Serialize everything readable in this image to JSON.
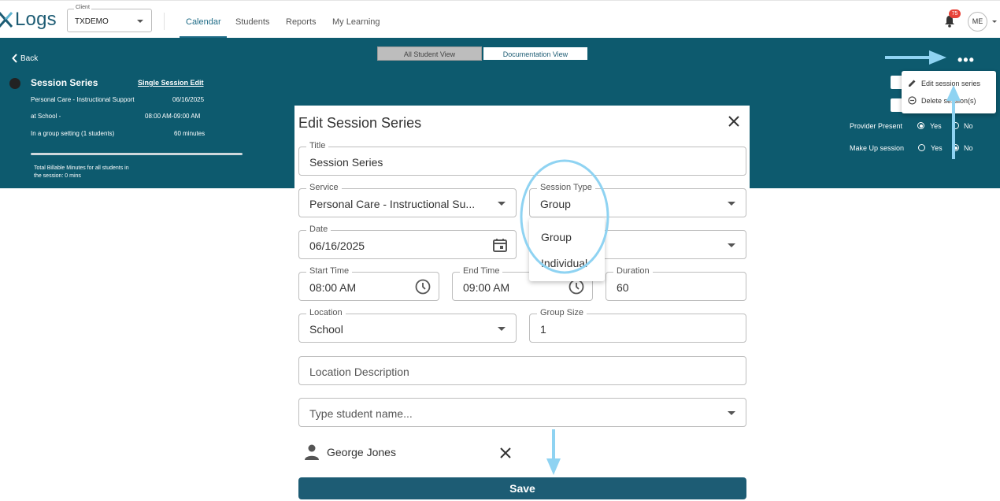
{
  "app": {
    "name": "Logs",
    "brand_color": "#1d5c74",
    "band_color": "#0d5a6e"
  },
  "client": {
    "label": "Client",
    "value": "TXDEMO"
  },
  "nav": [
    "Calendar",
    "Students",
    "Reports",
    "My Learning"
  ],
  "notifications": {
    "count": "75"
  },
  "user": {
    "initials": "ME"
  },
  "view_toggle": {
    "all": "All Student View",
    "doc": "Documentation View",
    "active": "Documentation View"
  },
  "back_label": "Back",
  "session_summary": {
    "title": "Session Series",
    "edit_link": "Single Session Edit",
    "service": "Personal Care - Instructional Support",
    "date": "06/16/2025",
    "location": "at School -",
    "time": "08:00 AM-09:00 AM",
    "group": "In a group setting (1 students)",
    "duration": "60 minutes",
    "billable_line1": "Total Billable Minutes for all students in",
    "billable_line2": "the session: 0 mins"
  },
  "right_panel": {
    "provider_present": {
      "label": "Provider Present",
      "yes": "Yes",
      "no": "No",
      "selected": "Yes"
    },
    "make_up": {
      "label": "Make Up session",
      "yes": "Yes",
      "no": "No",
      "selected": "No"
    }
  },
  "menu": {
    "edit": "Edit session series",
    "delete": "Delete session(s)"
  },
  "dialog": {
    "title": "Edit Session Series",
    "title_field": {
      "label": "Title",
      "value": "Session Series"
    },
    "service": {
      "label": "Service",
      "value": "Personal Care - Instructional Su..."
    },
    "session_type": {
      "label": "Session Type",
      "value": "Group",
      "options": [
        "Group",
        "Individual"
      ]
    },
    "date": {
      "label": "Date",
      "value": "06/16/2025"
    },
    "start_time": {
      "label": "Start Time",
      "value": "08:00 AM"
    },
    "end_time": {
      "label": "End Time",
      "value": "09:00 AM"
    },
    "duration": {
      "label": "Duration",
      "value": "60"
    },
    "location": {
      "label": "Location",
      "value": "School"
    },
    "group_size": {
      "label": "Group Size",
      "value": "1"
    },
    "location_description": {
      "placeholder": "Location Description"
    },
    "student_search": {
      "placeholder": "Type student name..."
    },
    "students": [
      "George Jones"
    ],
    "save_label": "Save"
  },
  "annotation_color": "#8fd3f2"
}
